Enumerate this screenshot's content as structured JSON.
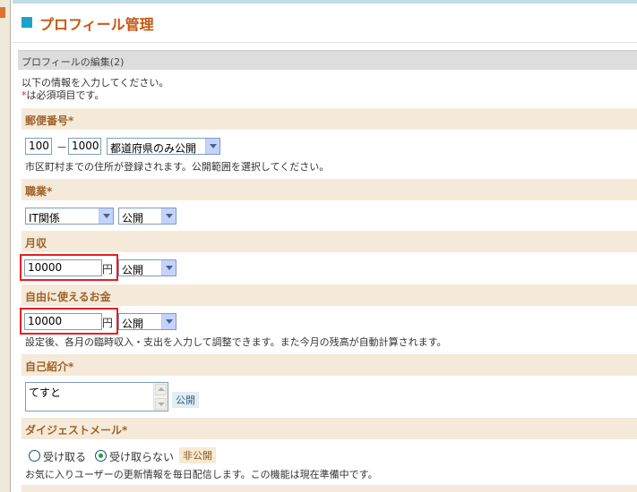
{
  "page": {
    "title": "プロフィール管理",
    "section_title": "プロフィールの編集(2)",
    "intro_line1": "以下の情報を入力してください。",
    "intro_req_mark": "*",
    "intro_line2": "は必須項目です。"
  },
  "postal": {
    "label": "郵便番号*",
    "part1": "100",
    "separator": "－",
    "part2": "1000",
    "visibility": "都道府県のみ公開",
    "help": "市区町村までの住所が登録されます。公開範囲を選択してください。"
  },
  "occupation": {
    "label": "職業*",
    "value": "IT関係",
    "visibility": "公開"
  },
  "monthly_income": {
    "label": "月収",
    "value": "10000",
    "unit": "円",
    "visibility": "公開"
  },
  "free_money": {
    "label": "自由に使えるお金",
    "value": "10000",
    "unit": "円",
    "visibility": "公開",
    "help": "設定後、各月の臨時収入・支出を入力して調整できます。また今月の残高が自動計算されます。"
  },
  "self_intro": {
    "label": "自己紹介*",
    "value": "てすと",
    "visibility_badge": "公開"
  },
  "digest_mail": {
    "label": "ダイジェストメール*",
    "options": [
      "受け取る",
      "受け取らない"
    ],
    "selected": "受け取らない",
    "visibility_badge": "非公開",
    "help": "お気に入りユーザーの更新情報を毎日配信します。この機能は現在準備中です。"
  },
  "colors": {
    "title": "#c8560f",
    "field_label": "#a0622a",
    "field_bg": "#f5ead9",
    "highlight_box": "#e81e1e",
    "accent_square": "#1aa3c8"
  }
}
